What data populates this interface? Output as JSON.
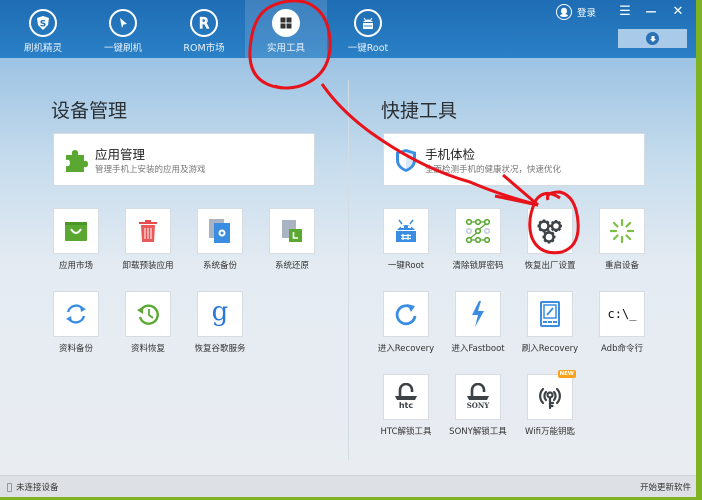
{
  "nav": {
    "tabs": [
      {
        "label": "刷机精灵",
        "icon": "shield-s-icon"
      },
      {
        "label": "一键刷机",
        "icon": "cursor-arrow-icon"
      },
      {
        "label": "ROM市场",
        "icon": "rom-r-icon"
      },
      {
        "label": "实用工具",
        "icon": "grid-icon",
        "active": true
      },
      {
        "label": "一键Root",
        "icon": "android-root-icon"
      }
    ],
    "login_label": "登录",
    "menu_icon": "☰",
    "minimize_icon": "—",
    "close_icon": "✕"
  },
  "device_management": {
    "title": "设备管理",
    "card": {
      "title": "应用管理",
      "subtitle": "管理手机上安装的应用及游戏"
    },
    "tiles": [
      {
        "label": "应用市场",
        "icon": "shopping-bag-icon"
      },
      {
        "label": "卸载预装应用",
        "icon": "trash-icon"
      },
      {
        "label": "系统备份",
        "icon": "system-backup-icon"
      },
      {
        "label": "系统还原",
        "icon": "system-restore-icon"
      },
      {
        "label": "资料备份",
        "icon": "sync-icon"
      },
      {
        "label": "资料恢复",
        "icon": "history-icon"
      },
      {
        "label": "恢复谷歌服务",
        "icon": "google-icon"
      }
    ]
  },
  "quick_tools": {
    "title": "快捷工具",
    "card": {
      "title": "手机体检",
      "subtitle": "全面检测手机的健康状况，快速优化"
    },
    "tiles": [
      {
        "label": "一键Root",
        "icon": "android-root-icon"
      },
      {
        "label": "清除锁屏密码",
        "icon": "pattern-lock-icon"
      },
      {
        "label": "恢复出厂设置",
        "icon": "gears-icon"
      },
      {
        "label": "重启设备",
        "icon": "loading-spinner-icon"
      },
      {
        "label": "进入Recovery",
        "icon": "refresh-arrow-icon"
      },
      {
        "label": "进入Fastboot",
        "icon": "lightning-icon"
      },
      {
        "label": "刷入Recovery",
        "icon": "tablet-edit-icon"
      },
      {
        "label": "Adb命令行",
        "icon": "terminal-icon",
        "glyph": "c:\\_"
      },
      {
        "label": "HTC解锁工具",
        "icon": "htc-unlock-icon",
        "brand": "htc"
      },
      {
        "label": "SONY解锁工具",
        "icon": "sony-unlock-icon",
        "brand": "SONY"
      },
      {
        "label": "Wifi万能钥匙",
        "icon": "wifi-key-icon",
        "badge": "NEW"
      }
    ]
  },
  "status": {
    "left": "未连接设备",
    "right": "开始更新软件"
  },
  "colors": {
    "topbar": "#1f6db4",
    "green": "#5aa832",
    "blue": "#3a8de0",
    "red_annotation": "#e8121a"
  }
}
